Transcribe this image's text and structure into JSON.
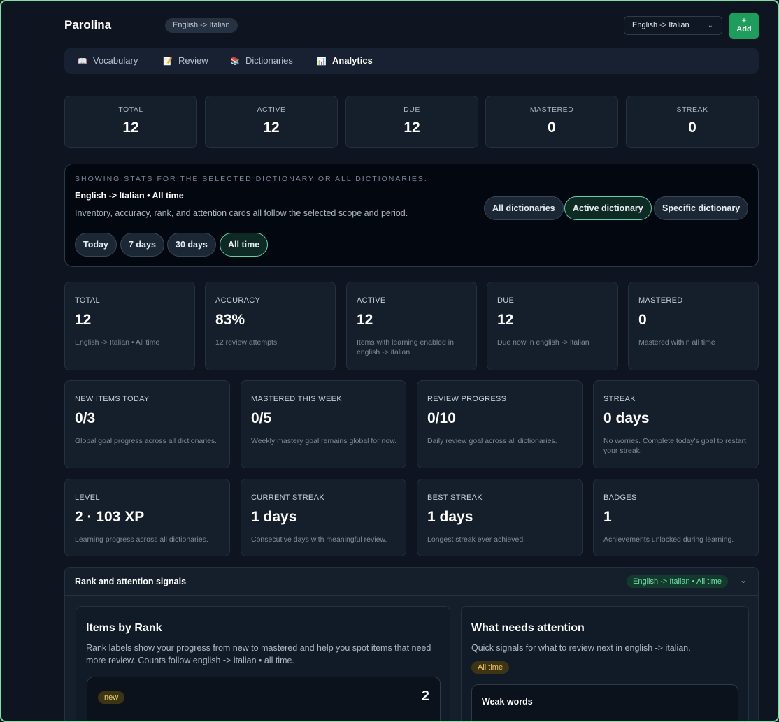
{
  "app": {
    "title": "Parolina",
    "pair_badge": "English -> Italian"
  },
  "header": {
    "lang_select": "English -> Italian",
    "add_button": {
      "plus": "+",
      "label": "Add"
    }
  },
  "nav": [
    {
      "label": "Vocabulary",
      "icon": "book-icon"
    },
    {
      "label": "Review",
      "icon": "note-icon"
    },
    {
      "label": "Dictionaries",
      "icon": "books-icon"
    },
    {
      "label": "Analytics",
      "icon": "bar-chart-icon",
      "active": true
    }
  ],
  "summary": [
    {
      "label": "TOTAL",
      "value": "12"
    },
    {
      "label": "ACTIVE",
      "value": "12"
    },
    {
      "label": "DUE",
      "value": "12"
    },
    {
      "label": "MASTERED",
      "value": "0"
    },
    {
      "label": "STREAK",
      "value": "0"
    }
  ],
  "scope": {
    "caption": "SHOWING STATS FOR THE SELECTED DICTIONARY OR ALL DICTIONARIES.",
    "title": "English -> Italian • All time",
    "description": "Inventory, accuracy, rank, and attention cards all follow the selected scope and period.",
    "periods": [
      "Today",
      "7 days",
      "30 days",
      "All time"
    ],
    "active_period": "All time",
    "dictionaries": [
      "All dictionaries",
      "Active dictionary",
      "Specific dictionary"
    ],
    "active_dictionary": "Active dictionary"
  },
  "metrics": [
    {
      "label": "TOTAL",
      "value": "12",
      "sub": "English -> Italian • All time"
    },
    {
      "label": "ACCURACY",
      "value": "83%",
      "sub": "12 review attempts"
    },
    {
      "label": "ACTIVE",
      "value": "12",
      "sub": "Items with learning enabled in english -> italian"
    },
    {
      "label": "DUE",
      "value": "12",
      "sub": "Due now in english -> italian"
    },
    {
      "label": "MASTERED",
      "value": "0",
      "sub": "Mastered within all time"
    }
  ],
  "goals": [
    {
      "label": "NEW ITEMS TODAY",
      "value": "0/3",
      "sub": "Global goal progress across all dictionaries."
    },
    {
      "label": "MASTERED THIS WEEK",
      "value": "0/5",
      "sub": "Weekly mastery goal remains global for now."
    },
    {
      "label": "REVIEW PROGRESS",
      "value": "0/10",
      "sub": "Daily review goal across all dictionaries."
    },
    {
      "label": "STREAK",
      "value": "0 days",
      "sub": "No worries. Complete today's goal to restart your streak."
    }
  ],
  "gamification": [
    {
      "label": "LEVEL",
      "value": "2 · 103 XP",
      "sub": "Learning progress across all dictionaries."
    },
    {
      "label": "CURRENT STREAK",
      "value": "1 days",
      "sub": "Consecutive days with meaningful review."
    },
    {
      "label": "BEST STREAK",
      "value": "1 days",
      "sub": "Longest streak ever achieved."
    },
    {
      "label": "BADGES",
      "value": "1",
      "sub": "Achievements unlocked during learning."
    }
  ],
  "rank": {
    "heading": "Rank and attention signals",
    "scope_tag": "English -> Italian • All time",
    "items_by_rank": {
      "title": "Items by Rank",
      "description": "Rank labels show your progress from new to mastered and help you spot items that need more review. Counts follow english -> italian • all time.",
      "first_rank": {
        "badge": "new",
        "count": "2"
      }
    },
    "attention": {
      "title": "What needs attention",
      "description": "Quick signals for what to review next in english -> italian.",
      "period_badge": "All time",
      "first_card": {
        "title": "Weak words"
      }
    }
  },
  "colors": {
    "accent": "#1f9d5c",
    "active_chip_border": "#5fd3a6",
    "background": "#0e1521"
  }
}
